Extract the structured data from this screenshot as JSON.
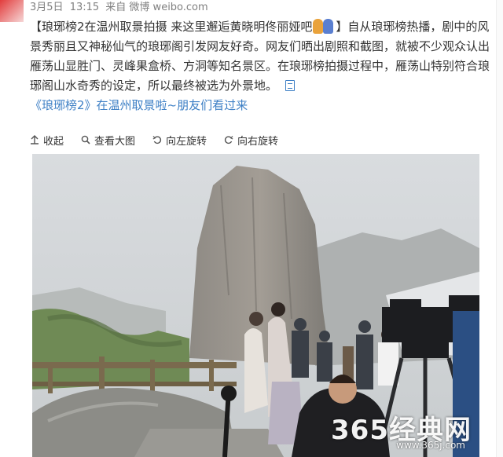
{
  "meta": {
    "date": "3月5日",
    "time": "13:15",
    "source": "来自 微博 weibo.com"
  },
  "post": {
    "text_main": "【琅琊榜2在温州取景拍摄 来这里邂逅黄晓明佟丽娅吧",
    "text_rest": "】自从琅琊榜热播，剧中的风景秀丽且又神秘仙气的琅琊阁引发网友好奇。网友们晒出剧照和截图，就被不少观众认出雁荡山显胜门、灵峰果盒桥、方洞等知名景区。在琅琊榜拍摄过程中，雁荡山特别符合琅琊阁山水奇秀的设定，所以最终被选为外景地。",
    "article_link": "《琅琊榜2》在温州取景啦~朋友们看过来"
  },
  "toolbar": {
    "collect": "收起",
    "view_large": "查看大图",
    "rotate_left": "向左旋转",
    "rotate_right": "向右旋转"
  },
  "watermark": {
    "main": "365经典网",
    "sub": "www.365j.com"
  },
  "colors": {
    "link_blue": "#3d7fc5",
    "meta_gray": "#808080",
    "text": "#333333"
  },
  "icons": {
    "collect": "arrow-up-icon",
    "view_large": "magnifier-icon",
    "rotate_left": "rotate-left-icon",
    "rotate_right": "rotate-right-icon",
    "article": "document-icon"
  }
}
